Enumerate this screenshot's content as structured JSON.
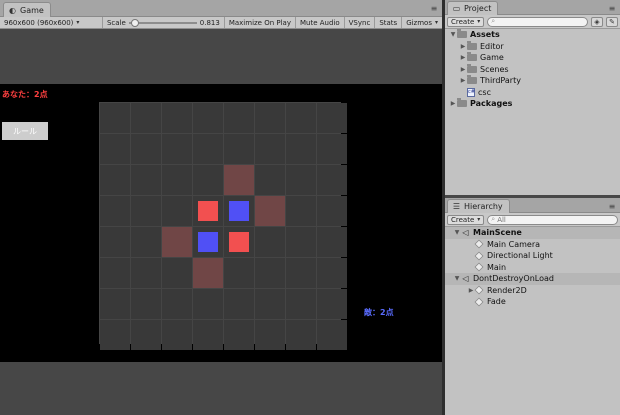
{
  "game_tab": {
    "label": "Game",
    "icon": "game-controller-icon"
  },
  "game_toolbar": {
    "resolution": "960x600 (960x600)",
    "scale_label": "Scale",
    "scale_value": "0.813",
    "maximize": "Maximize On Play",
    "mute": "Mute Audio",
    "vsync": "VSync",
    "stats": "Stats",
    "gizmos": "Gizmos"
  },
  "game": {
    "player_score": "あなた：2点",
    "enemy_score": "敵：2点",
    "rule_button": "ルール",
    "board_size": 8,
    "pieces": [
      {
        "row": 3,
        "col": 3,
        "color": "red"
      },
      {
        "row": 3,
        "col": 4,
        "color": "blue"
      },
      {
        "row": 4,
        "col": 3,
        "color": "blue"
      },
      {
        "row": 4,
        "col": 4,
        "color": "red"
      }
    ],
    "hints": [
      {
        "row": 2,
        "col": 4
      },
      {
        "row": 3,
        "col": 5
      },
      {
        "row": 4,
        "col": 2
      },
      {
        "row": 5,
        "col": 3
      }
    ],
    "colors": {
      "red": "#f25050",
      "blue": "#5050f5",
      "hint": "#704646",
      "cell": "#393939"
    }
  },
  "project": {
    "tab_label": "Project",
    "create_label": "Create",
    "search_placeholder": "",
    "items": [
      {
        "label": "Assets",
        "level": 0,
        "bold": true,
        "expanded": true,
        "type": "folder"
      },
      {
        "label": "Editor",
        "level": 1,
        "type": "folder"
      },
      {
        "label": "Game",
        "level": 1,
        "type": "folder"
      },
      {
        "label": "Scenes",
        "level": 1,
        "type": "folder"
      },
      {
        "label": "ThirdParty",
        "level": 1,
        "type": "folder"
      },
      {
        "label": "csc",
        "level": 1,
        "type": "file"
      },
      {
        "label": "Packages",
        "level": 0,
        "bold": true,
        "expanded": false,
        "type": "folder"
      }
    ]
  },
  "hierarchy": {
    "tab_label": "Hierarchy",
    "create_label": "Create",
    "search_placeholder": "All",
    "items": [
      {
        "label": "MainScene",
        "level": 0,
        "bold": true,
        "type": "scene",
        "expanded": true
      },
      {
        "label": "Main Camera",
        "level": 1,
        "type": "object"
      },
      {
        "label": "Directional Light",
        "level": 1,
        "type": "object"
      },
      {
        "label": "Main",
        "level": 1,
        "type": "object"
      },
      {
        "label": "DontDestroyOnLoad",
        "level": 0,
        "bold": false,
        "type": "scene",
        "expanded": true
      },
      {
        "label": "Render2D",
        "level": 1,
        "type": "object",
        "collapsed_child": true
      },
      {
        "label": "Fade",
        "level": 1,
        "type": "object"
      }
    ]
  }
}
